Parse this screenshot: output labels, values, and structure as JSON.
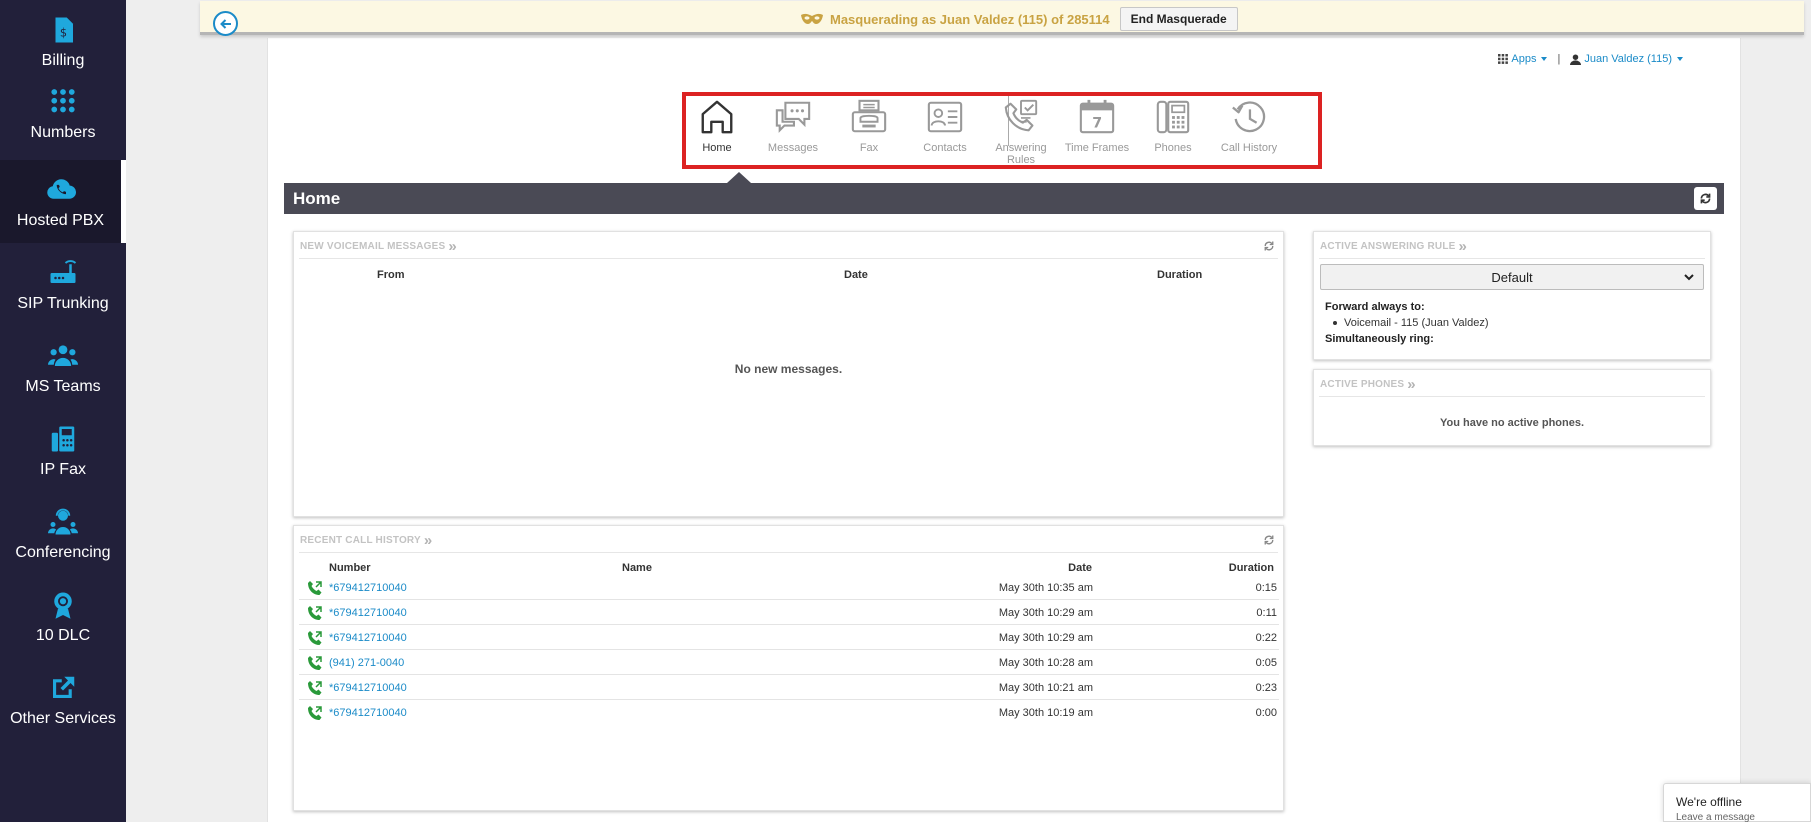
{
  "sidebar": {
    "items": [
      {
        "label": "Billing",
        "icon": "billing-icon"
      },
      {
        "label": "Numbers",
        "icon": "keypad-icon"
      },
      {
        "label": "Hosted PBX",
        "icon": "cloud-phone-icon",
        "active": true
      },
      {
        "label": "SIP Trunking",
        "icon": "router-icon"
      },
      {
        "label": "MS Teams",
        "icon": "team-icon"
      },
      {
        "label": "IP Fax",
        "icon": "fax-icon"
      },
      {
        "label": "Conferencing",
        "icon": "conference-icon"
      },
      {
        "label": "10 DLC",
        "icon": "badge-icon"
      },
      {
        "label": "Other Services",
        "icon": "external-link-icon"
      }
    ]
  },
  "masquerade": {
    "text": "Masquerading as Juan Valdez (115) of 285114",
    "end_button": "End Masquerade"
  },
  "user_nav": {
    "apps_label": "Apps",
    "separator": "|",
    "user_label": "Juan Valdez (115)"
  },
  "nav_tabs": [
    {
      "label": "Home",
      "icon": "home-icon",
      "active": true
    },
    {
      "label": "Messages",
      "icon": "messages-icon"
    },
    {
      "label": "Fax",
      "icon": "fax-icon"
    },
    {
      "label": "Contacts",
      "icon": "contacts-icon"
    },
    {
      "label": "Answering Rules",
      "icon": "answering-rules-icon"
    },
    {
      "label": "Time Frames",
      "icon": "calendar-icon"
    },
    {
      "label": "Phones",
      "icon": "desk-phone-icon"
    },
    {
      "label": "Call History",
      "icon": "history-icon"
    }
  ],
  "page_title": "Home",
  "voicemail": {
    "heading": "NEW VOICEMAIL MESSAGES",
    "columns": {
      "from": "From",
      "date": "Date",
      "duration": "Duration"
    },
    "empty_text": "No new messages."
  },
  "call_history": {
    "heading": "RECENT CALL HISTORY",
    "columns": {
      "number": "Number",
      "name": "Name",
      "date": "Date",
      "duration": "Duration"
    },
    "rows": [
      {
        "number": "*679412710040",
        "name": "",
        "date": "May 30th 10:35 am",
        "duration": "0:15"
      },
      {
        "number": "*679412710040",
        "name": "",
        "date": "May 30th 10:29 am",
        "duration": "0:11"
      },
      {
        "number": "*679412710040",
        "name": "",
        "date": "May 30th 10:29 am",
        "duration": "0:22"
      },
      {
        "number": "(941) 271-0040",
        "name": "",
        "date": "May 30th 10:28 am",
        "duration": "0:05"
      },
      {
        "number": "*679412710040",
        "name": "",
        "date": "May 30th 10:21 am",
        "duration": "0:23"
      },
      {
        "number": "*679412710040",
        "name": "",
        "date": "May 30th 10:19 am",
        "duration": "0:00"
      }
    ]
  },
  "answering_rule": {
    "heading": "ACTIVE ANSWERING RULE",
    "selected": "Default",
    "forward_label": "Forward always to:",
    "forward_target": "Voicemail - 115 (Juan Valdez)",
    "simultaneous_label": "Simultaneously ring:"
  },
  "active_phones": {
    "heading": "ACTIVE PHONES",
    "empty_text": "You have no active phones."
  },
  "chat": {
    "title": "We're offline",
    "subtitle": "Leave a message"
  },
  "colors": {
    "sidebar_bg": "#22203a",
    "accent_blue": "#1b8bc8",
    "icon_blue": "#1fa8dd",
    "title_bar": "#4a4a55",
    "masquerade_text": "#c9a343",
    "highlight_box": "#dc2222",
    "call_icon_green": "#2a9a3a"
  }
}
